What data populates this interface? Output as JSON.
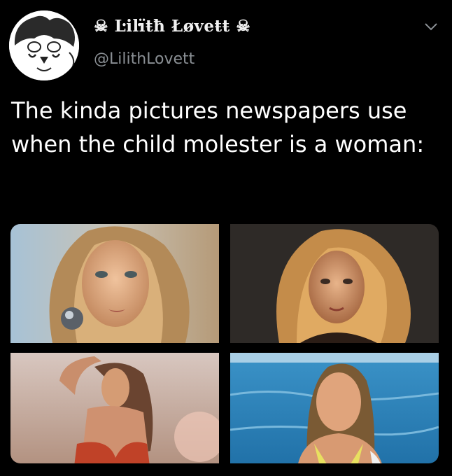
{
  "tweet": {
    "display_name": "☠ Ŀiŀïŧħ Łøvеŧŧ ☠",
    "handle": "@LilithLovett",
    "text": "The kinda pictures newspapers use when the child molester is a woman:",
    "media": [
      {
        "name": "photo-1",
        "subject": "blonde-woman-portrait"
      },
      {
        "name": "photo-2",
        "subject": "blonde-woman-sepia"
      },
      {
        "name": "photo-3",
        "subject": "woman-beach-swimsuit"
      },
      {
        "name": "photo-4",
        "subject": "woman-ocean-swimsuit"
      }
    ]
  },
  "icons": {
    "chevron": "chevron-down-icon",
    "avatar": "cartoon-avatar"
  },
  "colors": {
    "background": "#000000",
    "handle": "#8a8f94",
    "text": "#ffffff"
  }
}
